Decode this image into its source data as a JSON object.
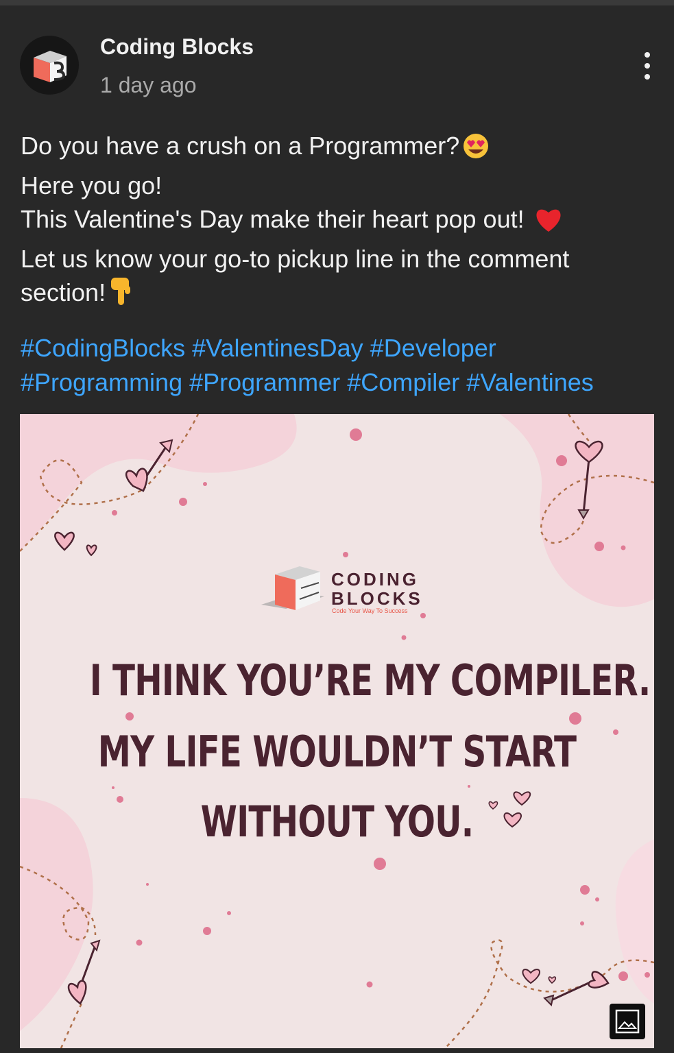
{
  "post": {
    "channel_name": "Coding Blocks",
    "time_ago": "1 day ago",
    "text_lines": [
      "Do you have a crush on a Programmer?",
      "Here you go!",
      "This Valentine's Day make their heart pop out!",
      "Let us know your go-to pickup line in the comment",
      "section!"
    ],
    "emojis": [
      "heart-eyes-emoji",
      "red-heart-emoji",
      "pointing-down-emoji"
    ],
    "hashtags_line1": [
      "#CodingBlocks",
      "#ValentinesDay",
      "#Developer"
    ],
    "hashtags_line2": [
      "#Programming",
      "#Programmer",
      "#Compiler",
      "#Valentines"
    ]
  },
  "image": {
    "logo_line1": "CODING",
    "logo_line2": "BLOCKS",
    "logo_tagline": "Code Your Way To Success",
    "quote_line1": "I THINK YOU’RE MY COMPILER.",
    "quote_line2": "MY LIFE WOULDN’T START",
    "quote_line3": "WITHOUT YOU.",
    "colors": {
      "background": "#f1e4e4",
      "blob": "#f3d0d8",
      "text": "#4a2330",
      "accent": "#e8708e"
    }
  },
  "icons": {
    "menu": "more-vertical-icon",
    "image_viewer": "image-icon"
  }
}
